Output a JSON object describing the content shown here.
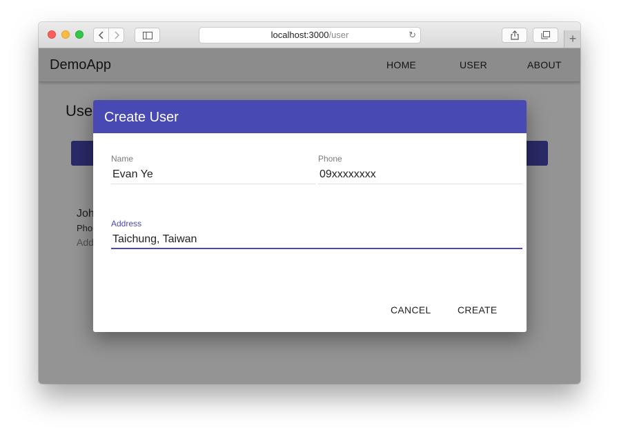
{
  "browser": {
    "url_host": "localhost:3000",
    "url_path": "/user",
    "icons": [
      "back-icon",
      "forward-icon",
      "sidebar-icon",
      "reload-icon",
      "share-icon",
      "tabs-icon",
      "new-tab-icon"
    ]
  },
  "app": {
    "brand": "DemoApp",
    "nav": [
      "HOME",
      "USER",
      "ABOUT"
    ]
  },
  "background_page": {
    "title_partial": "Use",
    "list_line1": "Joh",
    "list_line2": "Pho",
    "list_line3": "Add"
  },
  "dialog": {
    "title": "Create User",
    "fields": {
      "name": {
        "label": "Name",
        "value": "Evan Ye"
      },
      "phone": {
        "label": "Phone",
        "value": "09xxxxxxxx"
      },
      "address": {
        "label": "Address",
        "value": "Taichung, Taiwan"
      }
    },
    "actions": {
      "cancel": "CANCEL",
      "create": "CREATE"
    }
  },
  "colors": {
    "primary": "#4949b3",
    "scrim": "rgba(0,0,0,0.42)"
  }
}
